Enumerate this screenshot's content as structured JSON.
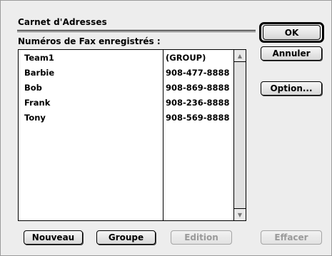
{
  "dialog": {
    "title": "Carnet d'Adresses",
    "subtitle": "Numéros de Fax enregistrés :"
  },
  "entries": [
    {
      "name": "Team1",
      "fax": "(GROUP)"
    },
    {
      "name": "Barbie",
      "fax": "908-477-8888"
    },
    {
      "name": "Bob",
      "fax": "908-869-8888"
    },
    {
      "name": "Frank",
      "fax": "908-236-8888"
    },
    {
      "name": "Tony",
      "fax": "908-569-8888"
    }
  ],
  "buttons": {
    "ok": "OK",
    "cancel": "Annuler",
    "option": "Option...",
    "new": "Nouveau",
    "group": "Groupe",
    "edit": "Edition",
    "delete": "Effacer"
  },
  "icons": {
    "scroll_up": "scroll-up-arrow-icon",
    "scroll_down": "scroll-down-arrow-icon"
  }
}
